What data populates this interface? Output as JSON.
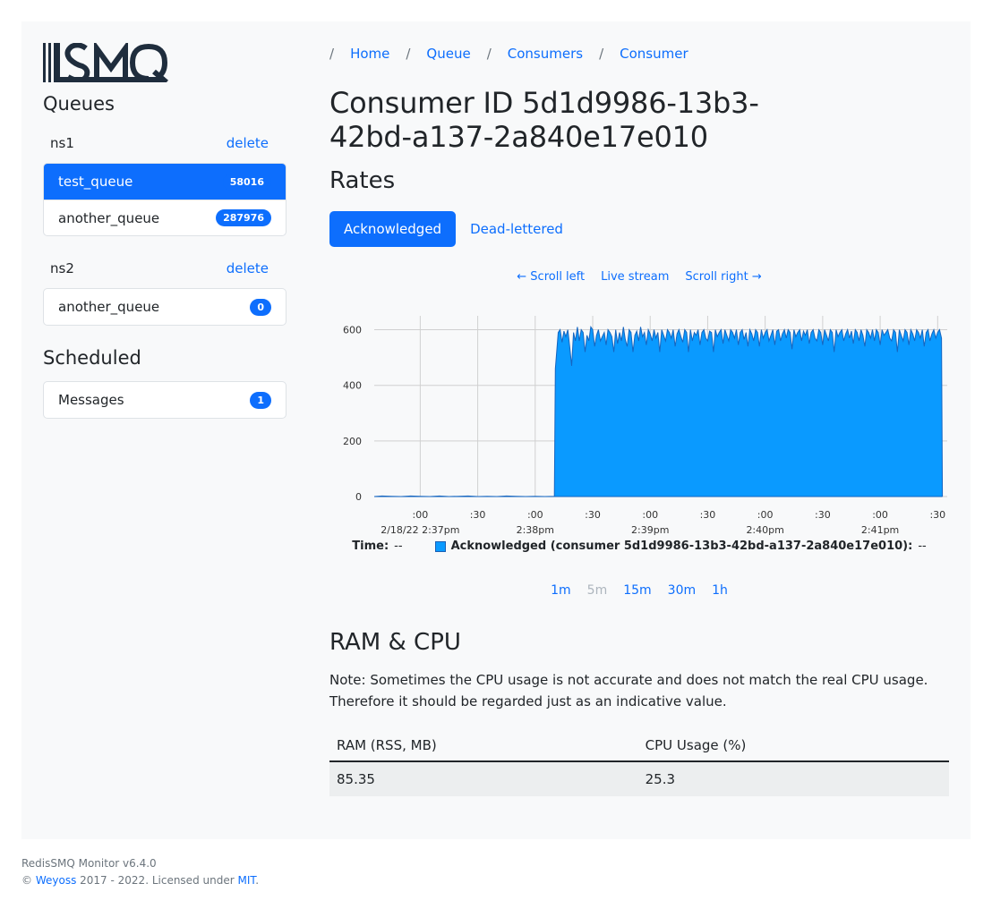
{
  "sidebar": {
    "logo_text": "RSMQ",
    "queues_heading": "Queues",
    "namespaces": [
      {
        "name": "ns1",
        "delete_label": "delete",
        "queues": [
          {
            "name": "test_queue",
            "count": "58016",
            "active": true
          },
          {
            "name": "another_queue",
            "count": "287976",
            "active": false
          }
        ]
      },
      {
        "name": "ns2",
        "delete_label": "delete",
        "queues": [
          {
            "name": "another_queue",
            "count": "0",
            "active": false
          }
        ]
      }
    ],
    "scheduled_heading": "Scheduled",
    "scheduled_items": [
      {
        "name": "Messages",
        "count": "1"
      }
    ]
  },
  "breadcrumb": {
    "sep": "/",
    "items": [
      "Home",
      "Queue",
      "Consumers",
      "Consumer"
    ]
  },
  "page_title": "Consumer ID 5d1d9986-13b3-42bd-a137-2a840e17e010",
  "rates": {
    "heading": "Rates",
    "tabs": [
      {
        "label": "Acknowledged",
        "active": true
      },
      {
        "label": "Dead-lettered",
        "active": false
      }
    ],
    "scroll_left": "← Scroll left",
    "live_stream": "Live stream",
    "scroll_right": "Scroll right →",
    "legend": {
      "time_label": "Time:",
      "time_value": "--",
      "series_label": "Acknowledged (consumer 5d1d9986-13b3-42bd-a137-2a840e17e010):",
      "series_value": "--",
      "swatch_color": "#0a9aff"
    },
    "ranges": [
      {
        "label": "1m",
        "disabled": false
      },
      {
        "label": "5m",
        "disabled": true
      },
      {
        "label": "15m",
        "disabled": false
      },
      {
        "label": "30m",
        "disabled": false
      },
      {
        "label": "1h",
        "disabled": false
      }
    ]
  },
  "chart_data": {
    "type": "area",
    "title": "",
    "xlabel": "",
    "ylabel": "",
    "ylim": [
      0,
      650
    ],
    "y_ticks": [
      0,
      200,
      400,
      600
    ],
    "x_ticks": [
      {
        "t": 0,
        "label": ":00",
        "sub": "2/18/22 2:37pm"
      },
      {
        "t": 30,
        "label": ":30",
        "sub": ""
      },
      {
        "t": 60,
        "label": ":00",
        "sub": "2:38pm"
      },
      {
        "t": 90,
        "label": ":30",
        "sub": ""
      },
      {
        "t": 120,
        "label": ":00",
        "sub": "2:39pm"
      },
      {
        "t": 150,
        "label": ":30",
        "sub": ""
      },
      {
        "t": 180,
        "label": ":00",
        "sub": "2:40pm"
      },
      {
        "t": 210,
        "label": ":30",
        "sub": ""
      },
      {
        "t": 240,
        "label": ":00",
        "sub": "2:41pm"
      },
      {
        "t": 270,
        "label": ":30",
        "sub": ""
      }
    ],
    "x_range": [
      -24,
      275
    ],
    "grid": true,
    "legend_position": "bottom",
    "series": [
      {
        "name": "Acknowledged (consumer 5d1d9986-13b3-42bd-a137-2a840e17e010)",
        "color": "#0a9aff",
        "points": [
          [
            -24,
            0
          ],
          [
            -20,
            2
          ],
          [
            -15,
            1
          ],
          [
            -10,
            0
          ],
          [
            -5,
            2
          ],
          [
            0,
            1
          ],
          [
            5,
            0
          ],
          [
            10,
            2
          ],
          [
            15,
            0
          ],
          [
            20,
            1
          ],
          [
            25,
            2
          ],
          [
            30,
            0
          ],
          [
            35,
            1
          ],
          [
            40,
            0
          ],
          [
            45,
            2
          ],
          [
            50,
            1
          ],
          [
            55,
            0
          ],
          [
            60,
            1
          ],
          [
            65,
            0
          ],
          [
            70,
            1
          ],
          [
            70.5,
            460
          ],
          [
            72,
            590
          ],
          [
            73,
            600
          ],
          [
            74,
            555
          ],
          [
            75,
            595
          ],
          [
            76,
            575
          ],
          [
            77,
            600
          ],
          [
            78,
            540
          ],
          [
            79,
            470
          ],
          [
            80,
            590
          ],
          [
            81,
            560
          ],
          [
            82,
            610
          ],
          [
            83,
            560
          ],
          [
            84,
            600
          ],
          [
            85,
            590
          ],
          [
            86,
            520
          ],
          [
            87,
            580
          ],
          [
            88,
            560
          ],
          [
            89,
            610
          ],
          [
            90,
            600
          ],
          [
            91,
            540
          ],
          [
            92,
            580
          ],
          [
            93,
            600
          ],
          [
            94,
            560
          ],
          [
            95,
            575
          ],
          [
            96,
            590
          ],
          [
            97,
            545
          ],
          [
            98,
            600
          ],
          [
            99,
            590
          ],
          [
            100,
            575
          ],
          [
            101,
            520
          ],
          [
            102,
            600
          ],
          [
            103,
            550
          ],
          [
            104,
            590
          ],
          [
            105,
            560
          ],
          [
            106,
            610
          ],
          [
            107,
            565
          ],
          [
            108,
            540
          ],
          [
            109,
            600
          ],
          [
            110,
            590
          ],
          [
            111,
            520
          ],
          [
            112,
            580
          ],
          [
            113,
            595
          ],
          [
            114,
            560
          ],
          [
            115,
            610
          ],
          [
            116,
            575
          ],
          [
            117,
            590
          ],
          [
            118,
            545
          ],
          [
            119,
            600
          ],
          [
            120,
            585
          ],
          [
            121,
            560
          ],
          [
            122,
            600
          ],
          [
            123,
            570
          ],
          [
            124,
            590
          ],
          [
            125,
            520
          ],
          [
            126,
            600
          ],
          [
            127,
            580
          ],
          [
            128,
            560
          ],
          [
            129,
            600
          ],
          [
            130,
            590
          ],
          [
            131,
            570
          ],
          [
            132,
            600
          ],
          [
            133,
            540
          ],
          [
            134,
            585
          ],
          [
            135,
            600
          ],
          [
            136,
            575
          ],
          [
            137,
            555
          ],
          [
            138,
            600
          ],
          [
            139,
            590
          ],
          [
            140,
            520
          ],
          [
            141,
            600
          ],
          [
            142,
            560
          ],
          [
            143,
            590
          ],
          [
            144,
            580
          ],
          [
            145,
            600
          ],
          [
            146,
            545
          ],
          [
            147,
            590
          ],
          [
            148,
            600
          ],
          [
            149,
            570
          ],
          [
            150,
            560
          ],
          [
            151,
            595
          ],
          [
            152,
            590
          ],
          [
            153,
            520
          ],
          [
            154,
            600
          ],
          [
            155,
            575
          ],
          [
            156,
            590
          ],
          [
            157,
            600
          ],
          [
            158,
            550
          ],
          [
            159,
            600
          ],
          [
            160,
            580
          ],
          [
            161,
            560
          ],
          [
            162,
            600
          ],
          [
            163,
            590
          ],
          [
            164,
            570
          ],
          [
            165,
            600
          ],
          [
            166,
            545
          ],
          [
            167,
            590
          ],
          [
            168,
            600
          ],
          [
            169,
            565
          ],
          [
            170,
            590
          ],
          [
            171,
            540
          ],
          [
            172,
            600
          ],
          [
            173,
            585
          ],
          [
            174,
            560
          ],
          [
            175,
            600
          ],
          [
            176,
            590
          ],
          [
            177,
            540
          ],
          [
            178,
            600
          ],
          [
            179,
            570
          ],
          [
            180,
            590
          ],
          [
            181,
            600
          ],
          [
            182,
            560
          ],
          [
            183,
            580
          ],
          [
            184,
            600
          ],
          [
            185,
            545
          ],
          [
            186,
            595
          ],
          [
            187,
            600
          ],
          [
            188,
            560
          ],
          [
            189,
            585
          ],
          [
            190,
            600
          ],
          [
            191,
            570
          ],
          [
            192,
            600
          ],
          [
            193,
            590
          ],
          [
            194,
            530
          ],
          [
            195,
            600
          ],
          [
            196,
            575
          ],
          [
            197,
            590
          ],
          [
            198,
            600
          ],
          [
            199,
            560
          ],
          [
            200,
            595
          ],
          [
            201,
            580
          ],
          [
            202,
            600
          ],
          [
            203,
            550
          ],
          [
            204,
            590
          ],
          [
            205,
            600
          ],
          [
            206,
            570
          ],
          [
            207,
            560
          ],
          [
            208,
            600
          ],
          [
            209,
            590
          ],
          [
            210,
            545
          ],
          [
            211,
            600
          ],
          [
            212,
            580
          ],
          [
            213,
            560
          ],
          [
            214,
            600
          ],
          [
            215,
            590
          ],
          [
            216,
            520
          ],
          [
            217,
            600
          ],
          [
            218,
            575
          ],
          [
            219,
            590
          ],
          [
            220,
            600
          ],
          [
            221,
            560
          ],
          [
            222,
            585
          ],
          [
            223,
            600
          ],
          [
            224,
            570
          ],
          [
            225,
            595
          ],
          [
            226,
            550
          ],
          [
            227,
            600
          ],
          [
            228,
            590
          ],
          [
            229,
            560
          ],
          [
            230,
            600
          ],
          [
            231,
            580
          ],
          [
            232,
            540
          ],
          [
            233,
            600
          ],
          [
            234,
            590
          ],
          [
            235,
            570
          ],
          [
            236,
            600
          ],
          [
            237,
            560
          ],
          [
            238,
            600
          ],
          [
            239,
            590
          ],
          [
            240,
            545
          ],
          [
            241,
            600
          ],
          [
            242,
            580
          ],
          [
            243,
            590
          ],
          [
            244,
            600
          ],
          [
            245,
            570
          ],
          [
            246,
            560
          ],
          [
            247,
            600
          ],
          [
            248,
            590
          ],
          [
            249,
            520
          ],
          [
            250,
            600
          ],
          [
            251,
            580
          ],
          [
            252,
            560
          ],
          [
            253,
            600
          ],
          [
            254,
            590
          ],
          [
            255,
            545
          ],
          [
            256,
            600
          ],
          [
            257,
            585
          ],
          [
            258,
            560
          ],
          [
            259,
            600
          ],
          [
            260,
            590
          ],
          [
            261,
            570
          ],
          [
            262,
            600
          ],
          [
            263,
            540
          ],
          [
            264,
            590
          ],
          [
            265,
            600
          ],
          [
            266,
            560
          ],
          [
            267,
            585
          ],
          [
            268,
            600
          ],
          [
            269,
            570
          ],
          [
            270,
            590
          ],
          [
            271,
            600
          ],
          [
            272,
            570
          ],
          [
            272.5,
            0
          ]
        ]
      }
    ]
  },
  "ram_cpu": {
    "heading": "RAM & CPU",
    "note": "Note: Sometimes the CPU usage is not accurate and does not match the real CPU usage. Therefore it should be regarded just as an indicative value.",
    "columns": [
      "RAM (RSS, MB)",
      "CPU Usage (%)"
    ],
    "row": [
      "85.35",
      "25.3"
    ]
  },
  "footer": {
    "version": "RedisSMQ Monitor v6.4.0",
    "copyright_prefix": "©",
    "author": "Weyoss",
    "years": "2017 - 2022. Licensed under",
    "license": "MIT",
    "period": "."
  }
}
